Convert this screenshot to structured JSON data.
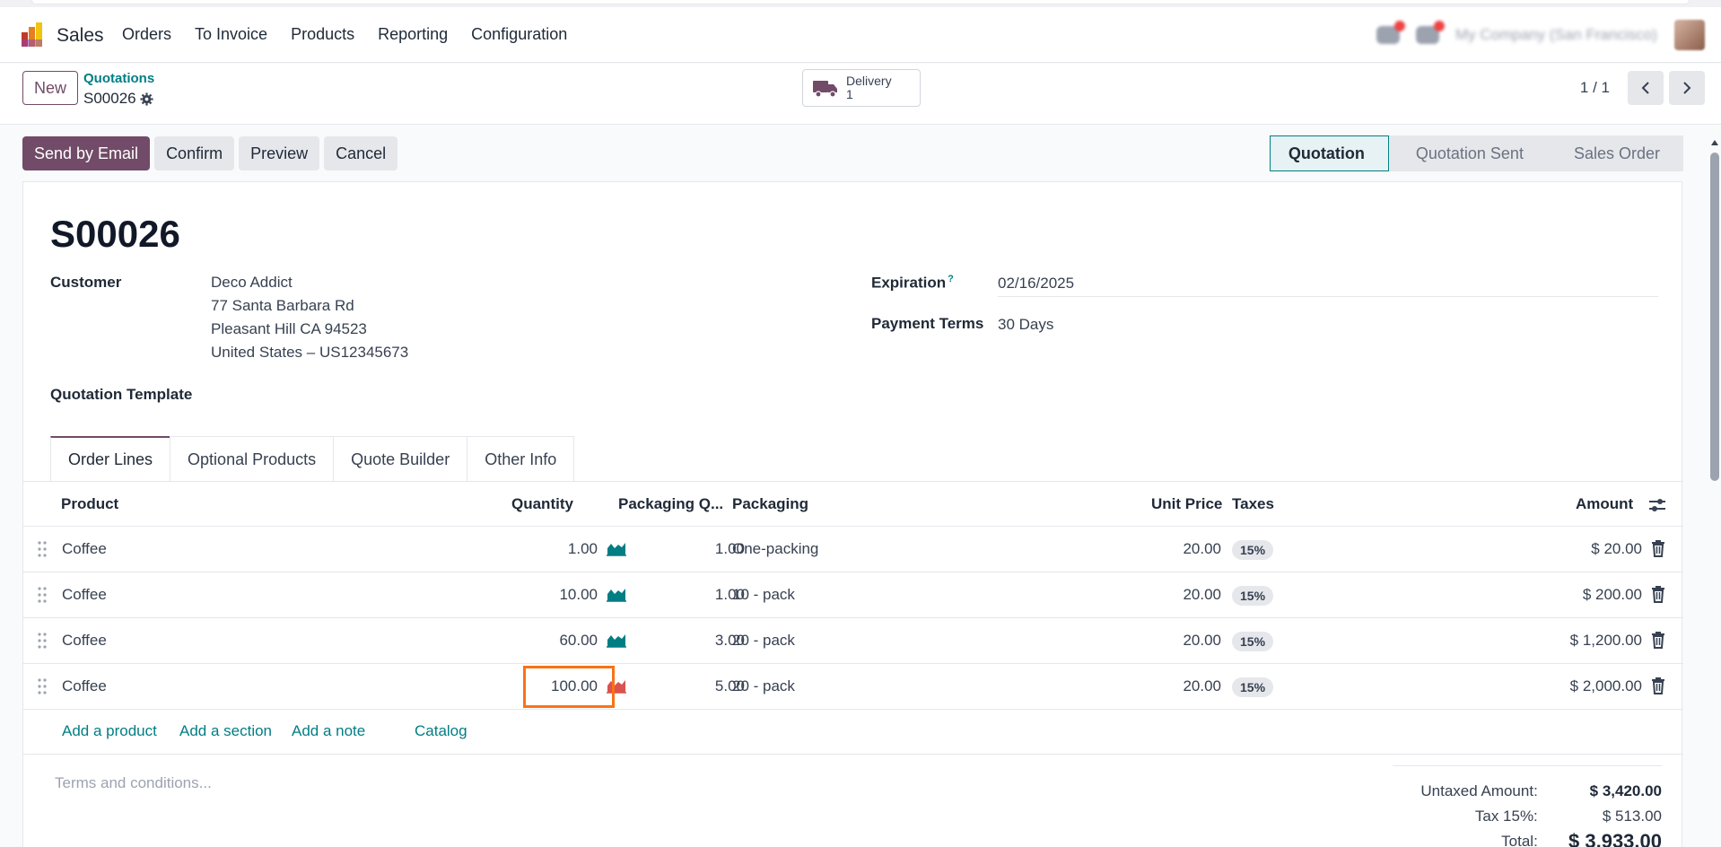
{
  "nav": {
    "app_name": "Sales",
    "menu": [
      "Orders",
      "To Invoice",
      "Products",
      "Reporting",
      "Configuration"
    ],
    "company": "My Company (San Francisco)"
  },
  "control_panel": {
    "new_label": "New",
    "breadcrumb_parent": "Quotations",
    "breadcrumb_current": "S00026",
    "delivery_label": "Delivery",
    "delivery_count": "1",
    "pager": "1 / 1"
  },
  "actions": {
    "send_email": "Send by Email",
    "confirm": "Confirm",
    "preview": "Preview",
    "cancel": "Cancel"
  },
  "status_stages": [
    "Quotation",
    "Quotation Sent",
    "Sales Order"
  ],
  "form": {
    "title": "S00026",
    "customer_label": "Customer",
    "customer_name": "Deco Addict",
    "customer_address1": "77 Santa Barbara Rd",
    "customer_address2": "Pleasant Hill CA 94523",
    "customer_address3": "United States – US12345673",
    "template_label": "Quotation Template",
    "expiration_label": "Expiration",
    "expiration_help": "?",
    "expiration_value": "02/16/2025",
    "payment_terms_label": "Payment Terms",
    "payment_terms_value": "30 Days"
  },
  "tabs": [
    "Order Lines",
    "Optional Products",
    "Quote Builder",
    "Other Info"
  ],
  "table": {
    "headers": {
      "product": "Product",
      "quantity": "Quantity",
      "packaging_qty": "Packaging Q...",
      "packaging": "Packaging",
      "unit_price": "Unit Price",
      "taxes": "Taxes",
      "amount": "Amount"
    },
    "rows": [
      {
        "product": "Coffee",
        "quantity": "1.00",
        "packaging_qty": "1.00",
        "packaging": "One-packing",
        "unit_price": "20.00",
        "tax": "15%",
        "amount": "$ 20.00"
      },
      {
        "product": "Coffee",
        "quantity": "10.00",
        "packaging_qty": "1.00",
        "packaging": "10 - pack",
        "unit_price": "20.00",
        "tax": "15%",
        "amount": "$ 200.00"
      },
      {
        "product": "Coffee",
        "quantity": "60.00",
        "packaging_qty": "3.00",
        "packaging": "20 - pack",
        "unit_price": "20.00",
        "tax": "15%",
        "amount": "$ 1,200.00"
      },
      {
        "product": "Coffee",
        "quantity": "100.00",
        "packaging_qty": "5.00",
        "packaging": "20 - pack",
        "unit_price": "20.00",
        "tax": "15%",
        "amount": "$ 2,000.00"
      }
    ],
    "add_product": "Add a product",
    "add_section": "Add a section",
    "add_note": "Add a note",
    "catalog": "Catalog"
  },
  "terms_placeholder": "Terms and conditions...",
  "totals": {
    "untaxed_label": "Untaxed Amount:",
    "untaxed_value": "$ 3,420.00",
    "tax_label": "Tax 15%:",
    "tax_value": "$ 513.00",
    "total_label": "Total:",
    "total_value": "$ 3,933.00"
  },
  "colors": {
    "brand": "#714b67",
    "accent": "#017e84",
    "forecast_ok": "#017e84",
    "forecast_warning": "#d9534f",
    "highlight": "#f97316"
  }
}
